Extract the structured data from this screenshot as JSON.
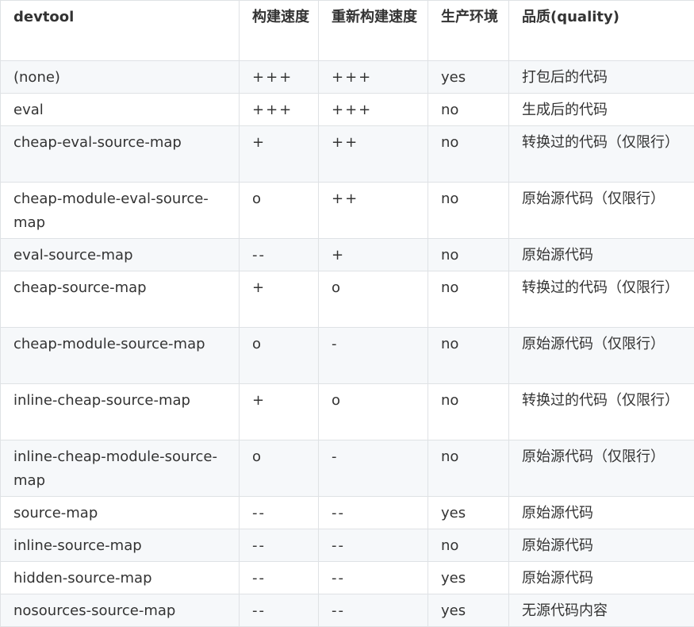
{
  "table": {
    "headers": [
      "devtool",
      "构建速度",
      "重新构建速度",
      "生产环境",
      "品质(quality)"
    ],
    "rows": [
      [
        "(none)",
        "+++",
        "+++",
        "yes",
        "打包后的代码"
      ],
      [
        "eval",
        "+++",
        "+++",
        "no",
        "生成后的代码"
      ],
      [
        "cheap-eval-source-map",
        "+",
        "++",
        "no",
        "转换过的代码（仅限行）"
      ],
      [
        "cheap-module-eval-source-map",
        "o",
        "++",
        "no",
        "原始源代码（仅限行）"
      ],
      [
        "eval-source-map",
        "--",
        "+",
        "no",
        "原始源代码"
      ],
      [
        "cheap-source-map",
        "+",
        "o",
        "no",
        "转换过的代码（仅限行）"
      ],
      [
        "cheap-module-source-map",
        "o",
        "-",
        "no",
        "原始源代码（仅限行）"
      ],
      [
        "inline-cheap-source-map",
        "+",
        "o",
        "no",
        "转换过的代码（仅限行）"
      ],
      [
        "inline-cheap-module-source-map",
        "o",
        "-",
        "no",
        "原始源代码（仅限行）"
      ],
      [
        "source-map",
        "--",
        "--",
        "yes",
        "原始源代码"
      ],
      [
        "inline-source-map",
        "--",
        "--",
        "no",
        "原始源代码"
      ],
      [
        "hidden-source-map",
        "--",
        "--",
        "yes",
        "原始源代码"
      ],
      [
        "nosources-source-map",
        "--",
        "--",
        "yes",
        "无源代码内容"
      ]
    ]
  }
}
